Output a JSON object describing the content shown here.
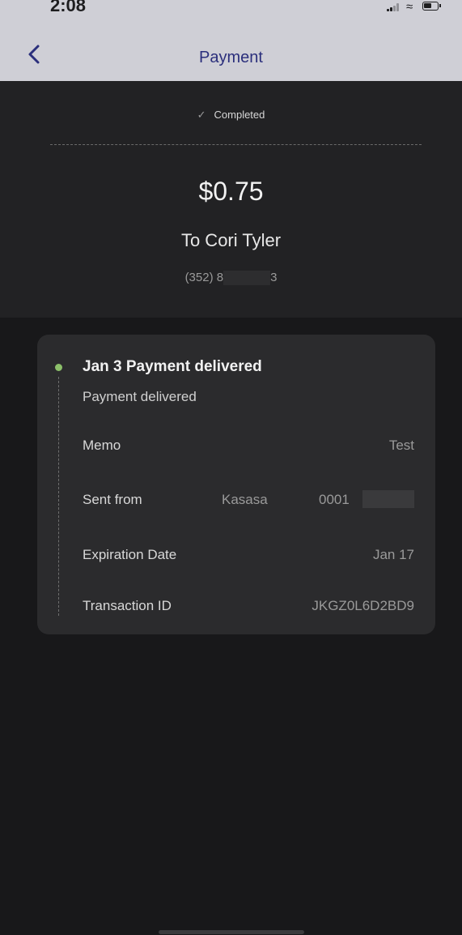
{
  "status_bar": {
    "time": "2:08"
  },
  "nav": {
    "title": "Payment"
  },
  "summary": {
    "status": "Completed",
    "amount": "$0.75",
    "recipient": "To Cori Tyler",
    "phone_prefix": "(352) 8",
    "phone_suffix": "3"
  },
  "details": {
    "event_title": "Jan 3 Payment delivered",
    "event_subtitle": "Payment delivered",
    "memo_label": "Memo",
    "memo_value": "Test",
    "sent_from_label": "Sent from",
    "sent_from_bank": "Kasasa",
    "sent_from_account": "0001",
    "expiration_label": "Expiration Date",
    "expiration_value": "Jan 17",
    "transaction_label": "Transaction ID",
    "transaction_value": "JKGZ0L6D2BD9"
  },
  "colors": {
    "nav_background": "#cfcfd6",
    "title": "#2b2f7c",
    "accent_green": "#8cc06a",
    "background": "#18181a"
  }
}
